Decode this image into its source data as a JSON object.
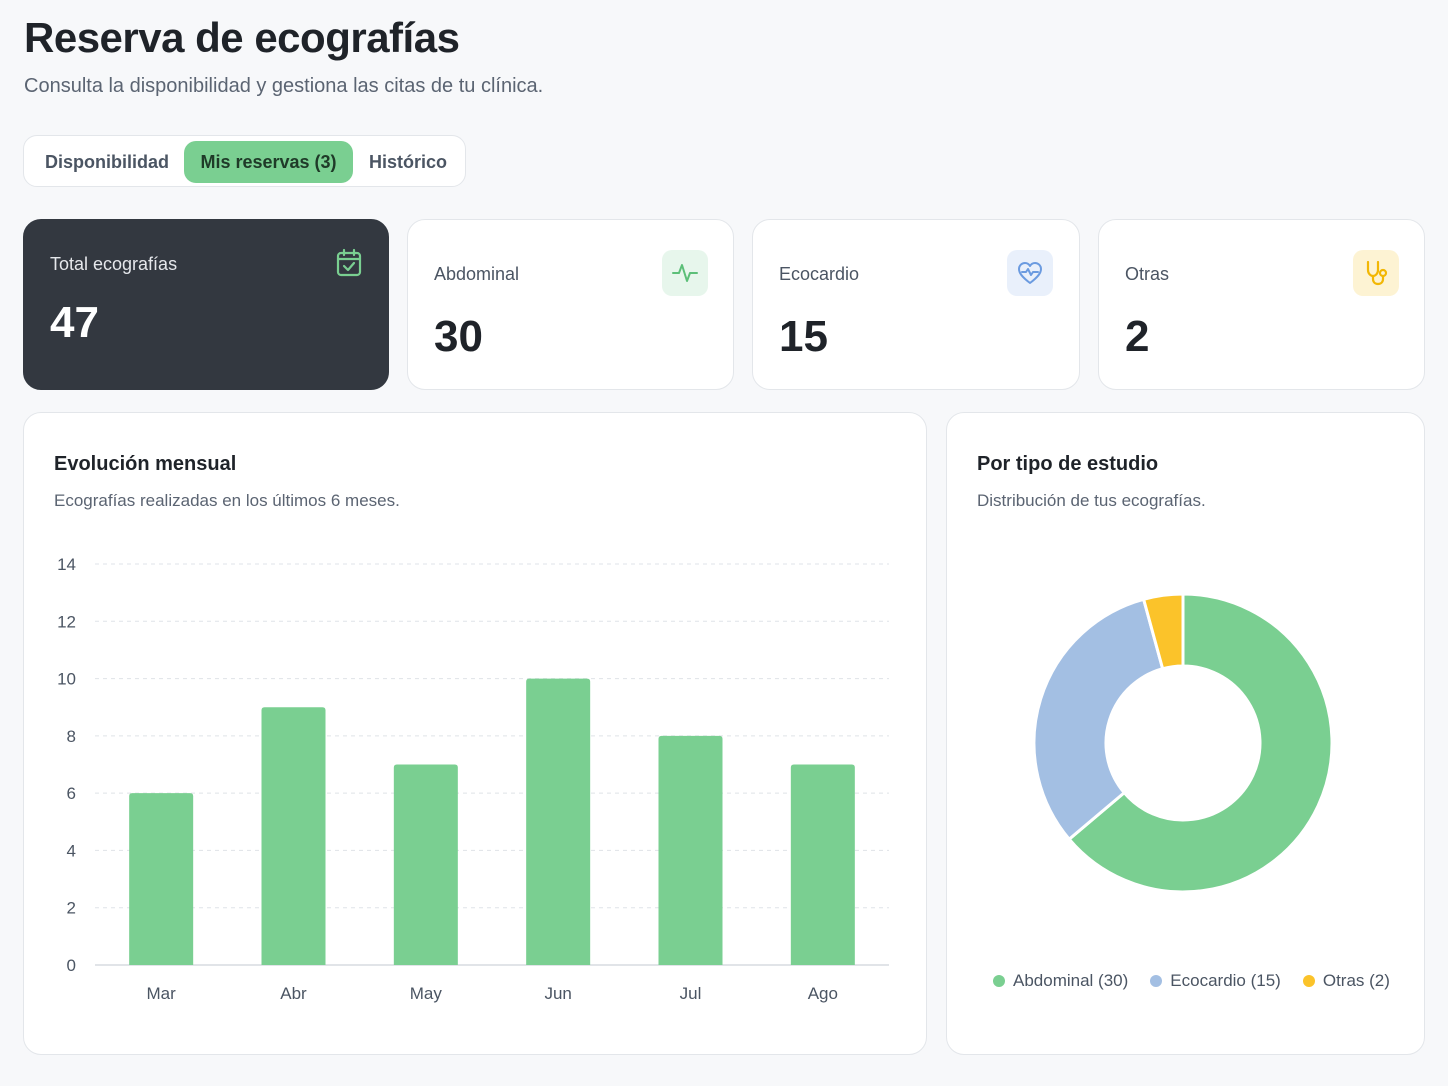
{
  "header": {
    "title": "Reserva de ecografías",
    "subtitle": "Consulta la disponibilidad y gestiona las citas de tu clínica."
  },
  "tabs": [
    {
      "label": "Disponibilidad",
      "active": false
    },
    {
      "label": "Mis reservas (3)",
      "active": true
    },
    {
      "label": "Histórico",
      "active": false
    }
  ],
  "stats": [
    {
      "label": "Total ecografías",
      "value": "47",
      "icon": "calendar-check-icon"
    },
    {
      "label": "Abdominal",
      "value": "30",
      "icon": "activity-pulse-icon",
      "icon_color": "#5cbf78",
      "icon_bg": "#e7f6ec"
    },
    {
      "label": "Ecocardio",
      "value": "15",
      "icon": "heart-pulse-icon",
      "icon_color": "#6b9be0",
      "icon_bg": "#e9f0fb"
    },
    {
      "label": "Otras",
      "value": "2",
      "icon": "stethoscope-icon",
      "icon_color": "#f2b705",
      "icon_bg": "#fdf3d3"
    }
  ],
  "monthly_panel": {
    "title": "Evolución mensual",
    "subtitle": "Ecografías realizadas en los últimos 6 meses."
  },
  "type_panel": {
    "title": "Por tipo de estudio",
    "subtitle": "Distribución de tus ecografías."
  },
  "chart_data": [
    {
      "type": "bar",
      "categories": [
        "Mar",
        "Abr",
        "May",
        "Jun",
        "Jul",
        "Ago"
      ],
      "values": [
        6,
        9,
        7,
        10,
        8,
        7
      ],
      "ylim": [
        0,
        14
      ],
      "yticks": [
        0,
        2,
        4,
        6,
        8,
        10,
        12,
        14
      ],
      "grid": true,
      "color": "#7acf91"
    },
    {
      "type": "pie",
      "donut": true,
      "labels": [
        "Abdominal",
        "Ecocardio",
        "Otras"
      ],
      "values": [
        30,
        15,
        2
      ],
      "legend": [
        "Abdominal (30)",
        "Ecocardio (15)",
        "Otras (2)"
      ],
      "colors": [
        "#7acf91",
        "#a3bfe3",
        "#fbc32a"
      ],
      "legend_position": "bottom"
    }
  ]
}
